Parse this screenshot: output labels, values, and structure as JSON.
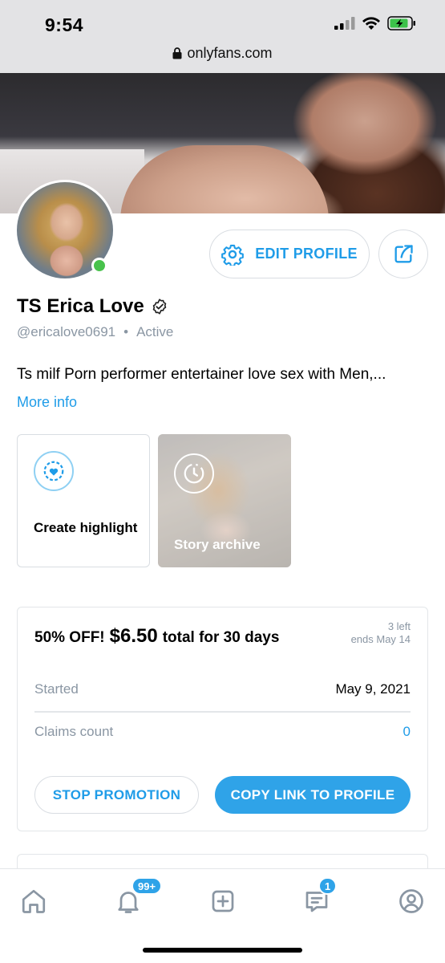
{
  "status_bar": {
    "time": "9:54"
  },
  "browser": {
    "url": "onlyfans.com"
  },
  "profile": {
    "name": "TS Erica Love",
    "handle": "@ericalove0691",
    "status": "Active",
    "bio": "Ts milf Porn performer entertainer love sex with Men,...",
    "more_info": "More info",
    "edit_profile_label": "EDIT PROFILE"
  },
  "highlights": {
    "create_label": "Create highlight",
    "archive_label": "Story archive"
  },
  "promotion": {
    "discount": "50% OFF!",
    "price": "$6.50",
    "terms": "total for 30 days",
    "left": "3 left",
    "ends": "ends May 14",
    "started_label": "Started",
    "started_value": "May 9, 2021",
    "claims_label": "Claims count",
    "claims_value": "0",
    "stop_label": "STOP PROMOTION",
    "copy_label": "COPY LINK TO PROFILE"
  },
  "nav": {
    "notifications_badge": "99+",
    "messages_badge": "1",
    "items": [
      "home-icon",
      "bell-icon",
      "add-post-icon",
      "messages-icon",
      "profile-icon"
    ]
  },
  "colors": {
    "accent": "#1f9ce8",
    "online": "#48c24c",
    "muted": "#8a96a3"
  }
}
